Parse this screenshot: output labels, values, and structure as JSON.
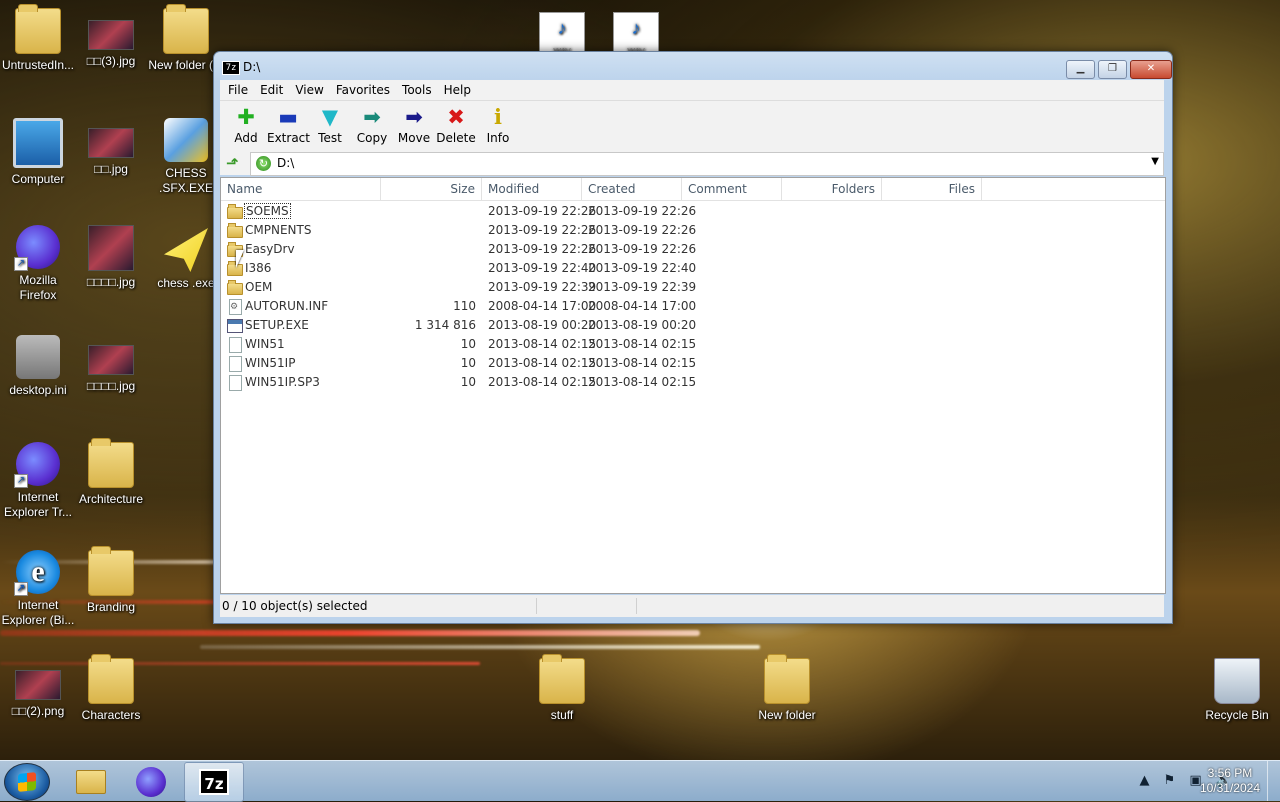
{
  "desktop": {
    "icons": [
      {
        "label": "UntrustedIn..."
      },
      {
        "label": "□□(3).jpg"
      },
      {
        "label": "New folder (2)"
      },
      {
        "label": "Computer"
      },
      {
        "label": "□□.jpg"
      },
      {
        "label": "CHESS .SFX.EXE"
      },
      {
        "label": "Mozilla Firefox"
      },
      {
        "label": "□□□□.jpg"
      },
      {
        "label": "chess .exe"
      },
      {
        "label": "desktop.ini"
      },
      {
        "label": "□□□□.jpg"
      },
      {
        "label": "Internet Explorer Tr..."
      },
      {
        "label": "Architecture"
      },
      {
        "label": "Internet Explorer (Bi..."
      },
      {
        "label": "Branding"
      },
      {
        "label": "□□(2).png"
      },
      {
        "label": "Characters"
      },
      {
        "label": "stuff"
      },
      {
        "label": "New folder"
      },
      {
        "label": "Recycle Bin"
      },
      {
        "label": "WAV"
      },
      {
        "label": "WAV"
      }
    ]
  },
  "window": {
    "badge": "7z",
    "title": "D:\\",
    "controls": {
      "minimize": "▁",
      "maximize": "❐",
      "close": "✕"
    }
  },
  "menu": [
    "File",
    "Edit",
    "View",
    "Favorites",
    "Tools",
    "Help"
  ],
  "toolbar": [
    {
      "label": "Add",
      "icon": "✚",
      "color": "#22b022"
    },
    {
      "label": "Extract",
      "icon": "▬",
      "color": "#1a3ab8"
    },
    {
      "label": "Test",
      "icon": "▼",
      "color": "#20b8c8"
    },
    {
      "label": "Copy",
      "icon": "➡",
      "color": "#1a8a7a"
    },
    {
      "label": "Move",
      "icon": "➡",
      "color": "#1a1a8a"
    },
    {
      "label": "Delete",
      "icon": "✖",
      "color": "#d81818"
    },
    {
      "label": "Info",
      "icon": "ℹ",
      "color": "#c8a800"
    }
  ],
  "address": {
    "path": "D:\\"
  },
  "columns": [
    "Name",
    "Size",
    "Modified",
    "Created",
    "Comment",
    "Folders",
    "Files"
  ],
  "files": [
    {
      "name": "SOEMS",
      "size": "",
      "modified": "2013-09-19 22:26",
      "created": "2013-09-19 22:26",
      "type": "folder"
    },
    {
      "name": "CMPNENTS",
      "size": "",
      "modified": "2013-09-19 22:26",
      "created": "2013-09-19 22:26",
      "type": "folder"
    },
    {
      "name": "EasyDrv",
      "size": "",
      "modified": "2013-09-19 22:26",
      "created": "2013-09-19 22:26",
      "type": "folder"
    },
    {
      "name": "I386",
      "size": "",
      "modified": "2013-09-19 22:40",
      "created": "2013-09-19 22:40",
      "type": "folder"
    },
    {
      "name": "OEM",
      "size": "",
      "modified": "2013-09-19 22:39",
      "created": "2013-09-19 22:39",
      "type": "folder"
    },
    {
      "name": "AUTORUN.INF",
      "size": "110",
      "modified": "2008-04-14 17:00",
      "created": "2008-04-14 17:00",
      "type": "ini"
    },
    {
      "name": "SETUP.EXE",
      "size": "1 314 816",
      "modified": "2013-08-19 00:20",
      "created": "2013-08-19 00:20",
      "type": "exe"
    },
    {
      "name": "WIN51",
      "size": "10",
      "modified": "2013-08-14 02:15",
      "created": "2013-08-14 02:15",
      "type": "file"
    },
    {
      "name": "WIN51IP",
      "size": "10",
      "modified": "2013-08-14 02:15",
      "created": "2013-08-14 02:15",
      "type": "file"
    },
    {
      "name": "WIN51IP.SP3",
      "size": "10",
      "modified": "2013-08-14 02:15",
      "created": "2013-08-14 02:15",
      "type": "file"
    }
  ],
  "status": {
    "selection": "0 / 10 object(s) selected"
  },
  "taskbar": {
    "clock_time": "3:56 PM",
    "clock_date": "10/31/2024",
    "tray_icons": [
      "chevron-up",
      "flag",
      "network",
      "volume"
    ],
    "tray_glyphs": [
      "▲",
      "⚑",
      "▣",
      "🔊"
    ],
    "apps": [
      "file-explorer",
      "firefox",
      "7-zip"
    ]
  }
}
